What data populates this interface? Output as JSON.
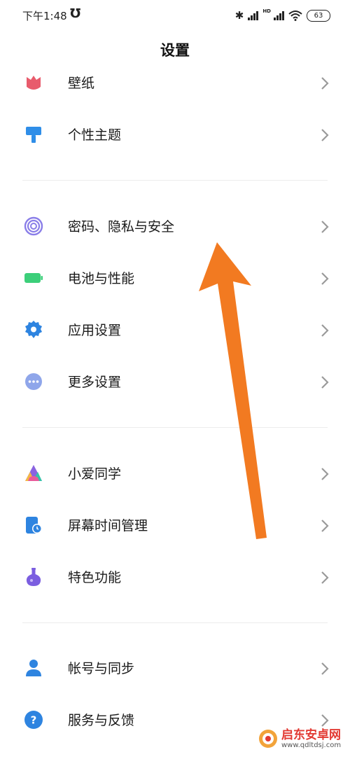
{
  "status_bar": {
    "time": "下午1:48",
    "sync_icon": "sync-icon",
    "hd_label": "HD",
    "battery_level": "63"
  },
  "header": {
    "title": "设置"
  },
  "settings": {
    "items": [
      {
        "label": "壁纸",
        "icon": "wallpaper-icon",
        "color": "#e85b6c"
      },
      {
        "label": "个性主题",
        "icon": "brush-icon",
        "color": "#2f8ee8"
      },
      {
        "label": "密码、隐私与安全",
        "icon": "fingerprint-icon",
        "color": "#8a7ee8"
      },
      {
        "label": "电池与性能",
        "icon": "battery-icon",
        "color": "#3ccf7a"
      },
      {
        "label": "应用设置",
        "icon": "gear-icon",
        "color": "#2e84e0"
      },
      {
        "label": "更多设置",
        "icon": "more-icon",
        "color": "#8fa6ea"
      },
      {
        "label": "小爱同学",
        "icon": "xiaoai-icon",
        "color": "#8a63e0"
      },
      {
        "label": "屏幕时间管理",
        "icon": "screen-time-icon",
        "color": "#2e84e0"
      },
      {
        "label": "特色功能",
        "icon": "flask-icon",
        "color": "#7b5ee0"
      },
      {
        "label": "帐号与同步",
        "icon": "account-icon",
        "color": "#2e84e0"
      },
      {
        "label": "服务与反馈",
        "icon": "help-icon",
        "color": "#2e84e0"
      }
    ]
  },
  "annotation": {
    "arrow_color": "#f27a21"
  },
  "watermark": {
    "text": "启东安卓网",
    "url": "www.qdltdsj.com"
  }
}
